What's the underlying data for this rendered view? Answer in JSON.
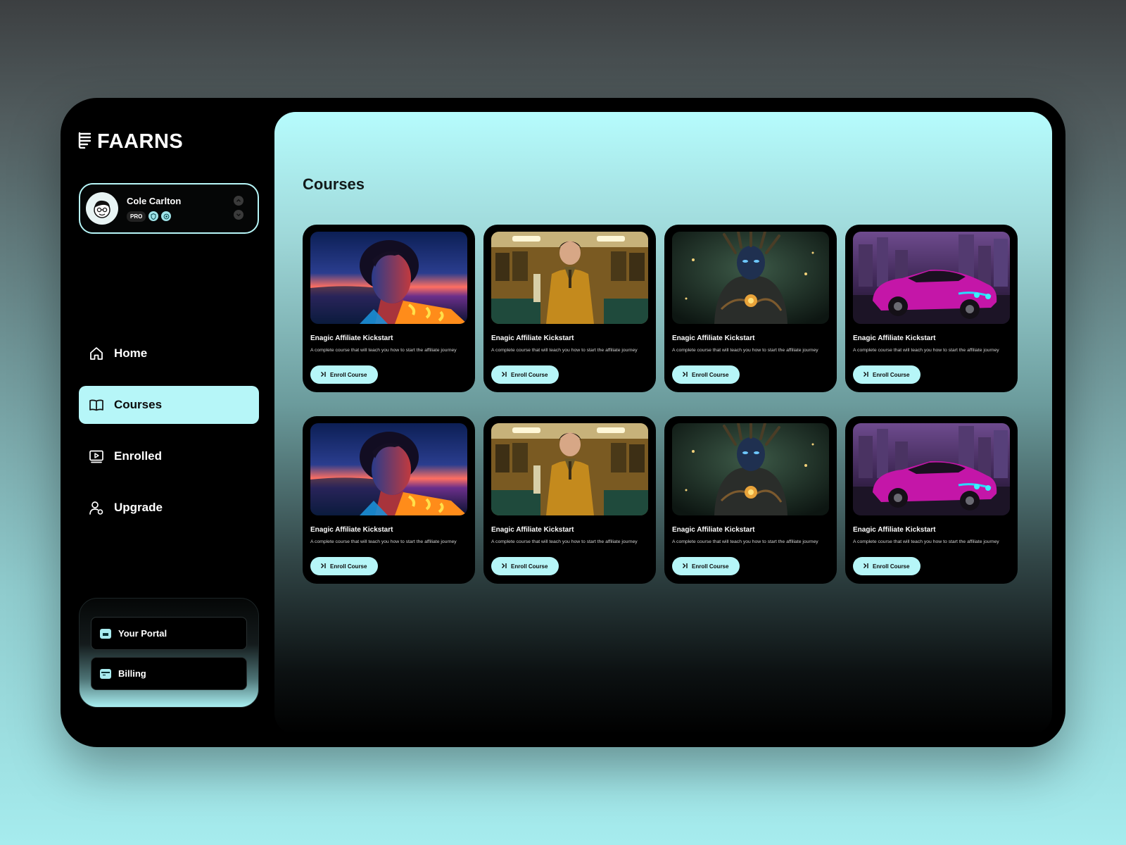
{
  "brand": {
    "name": "FAARNS"
  },
  "user": {
    "name": "Cole Carlton",
    "badge": "PRO"
  },
  "nav": {
    "items": [
      {
        "label": "Home",
        "icon": "home-icon"
      },
      {
        "label": "Courses",
        "icon": "book-icon",
        "active": true
      },
      {
        "label": "Enrolled",
        "icon": "video-icon"
      },
      {
        "label": "Upgrade",
        "icon": "user-plus-icon"
      }
    ]
  },
  "bottom": {
    "portal": "Your Portal",
    "billing": "Billing"
  },
  "page": {
    "title": "Courses"
  },
  "courses": [
    {
      "title": "Enagic Affiliate Kickstart",
      "description": "A complete course that will teach you how to start the affiliate journey",
      "button": "Enroll Course",
      "image": "neon-portrait"
    },
    {
      "title": "Enagic Affiliate Kickstart",
      "description": "A complete course that will teach you how to start the affiliate journey",
      "button": "Enroll Course",
      "image": "man-in-train"
    },
    {
      "title": "Enagic Affiliate Kickstart",
      "description": "A complete course that will teach you how to start the affiliate journey",
      "button": "Enroll Course",
      "image": "forest-creature"
    },
    {
      "title": "Enagic Affiliate Kickstart",
      "description": "A complete course that will teach you how to start the affiliate journey",
      "button": "Enroll Course",
      "image": "magenta-muscle-car"
    },
    {
      "title": "Enagic Affiliate Kickstart",
      "description": "A complete course that will teach you how to start the affiliate journey",
      "button": "Enroll Course",
      "image": "neon-portrait"
    },
    {
      "title": "Enagic Affiliate Kickstart",
      "description": "A complete course that will teach you how to start the affiliate journey",
      "button": "Enroll Course",
      "image": "man-in-train"
    },
    {
      "title": "Enagic Affiliate Kickstart",
      "description": "A complete course that will teach you how to start the affiliate journey",
      "button": "Enroll Course",
      "image": "forest-creature"
    },
    {
      "title": "Enagic Affiliate Kickstart",
      "description": "A complete course that will teach you how to start the affiliate journey",
      "button": "Enroll Course",
      "image": "magenta-muscle-car"
    }
  ],
  "colors": {
    "accent": "#b6f6f8",
    "panel": "#000000"
  }
}
